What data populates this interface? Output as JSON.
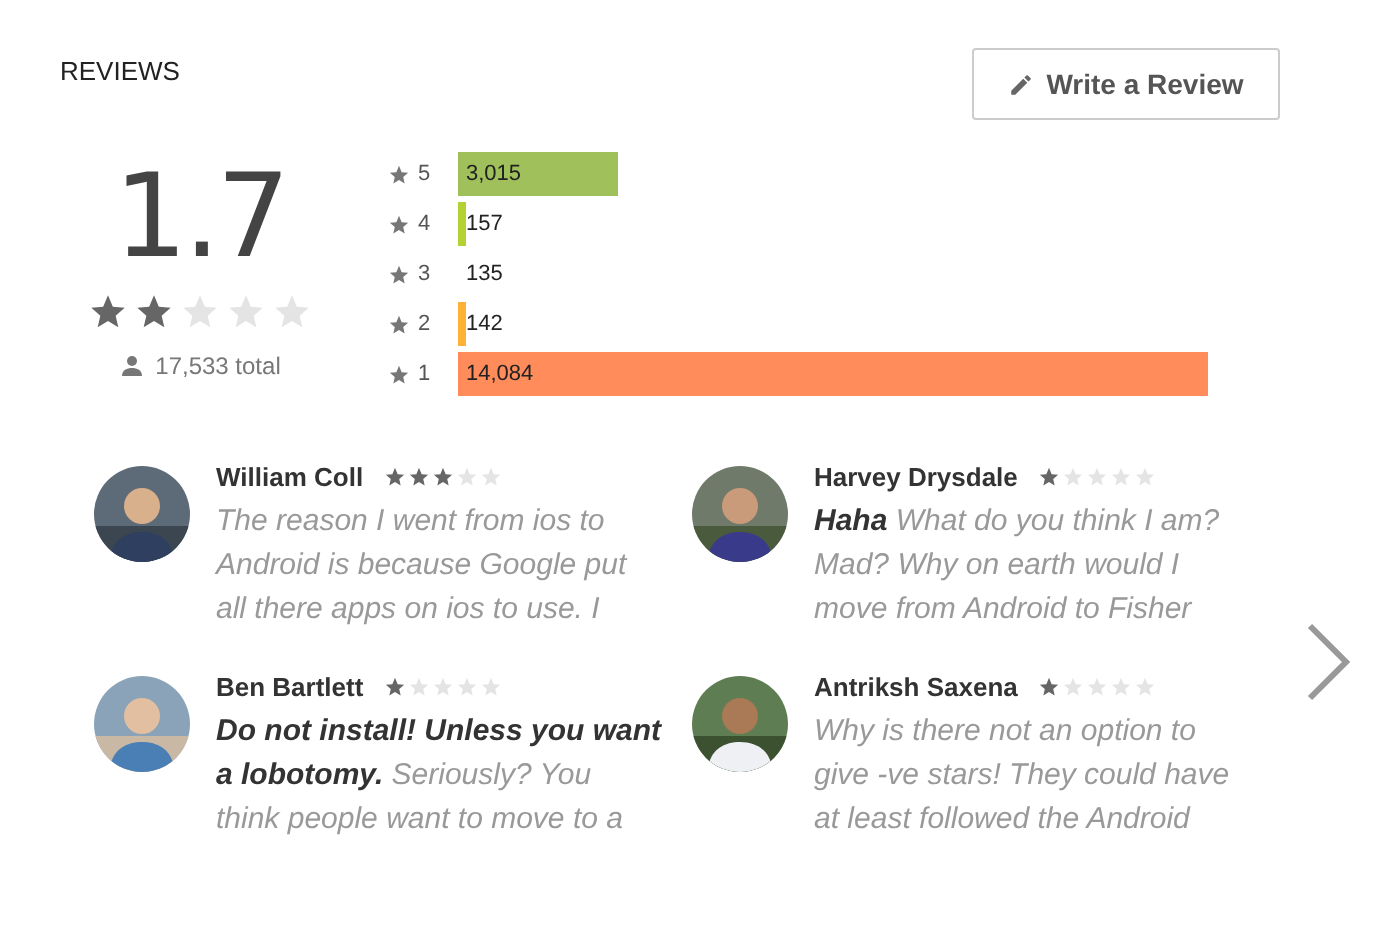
{
  "section_title": "REVIEWS",
  "write_button": {
    "label": "Write a Review"
  },
  "summary": {
    "score": "1.7",
    "stars": 2,
    "total": "17,533 total"
  },
  "histogram": [
    {
      "label": "5",
      "count": "3,015",
      "level": 0.214,
      "color": "#9fc05a"
    },
    {
      "label": "4",
      "count": "157",
      "level": 0.011,
      "color": "#b3d334"
    },
    {
      "label": "3",
      "count": "135"
    },
    {
      "label": "2",
      "count": "142",
      "level": 0.01,
      "color": "#ffb235"
    },
    {
      "label": "1",
      "count": "14,084",
      "level": 1,
      "color": "#ff8c5a"
    }
  ],
  "reviews": [
    {
      "author": "William Coll",
      "stars": 3,
      "lines": [
        "The reason I went from ios to",
        "Android is because Google put",
        "all there apps on ios to use. I"
      ]
    },
    {
      "author": "Harvey Drysdale",
      "stars": 1,
      "lines": [
        "**Haha** What do you think I am?",
        "Mad? Why on earth would I",
        "move from Android to Fisher"
      ]
    },
    {
      "author": "Ben Bartlett",
      "stars": 1,
      "lines": [
        "**Do not install! Unless you want**",
        "**a lobotomy.** Seriously? You",
        "think people want to move to a"
      ]
    },
    {
      "author": "Antriksh Saxena",
      "stars": 1,
      "lines": [
        "Why is there not an option to",
        "give -ve stars! They could have",
        "at least followed the Android"
      ]
    }
  ]
}
